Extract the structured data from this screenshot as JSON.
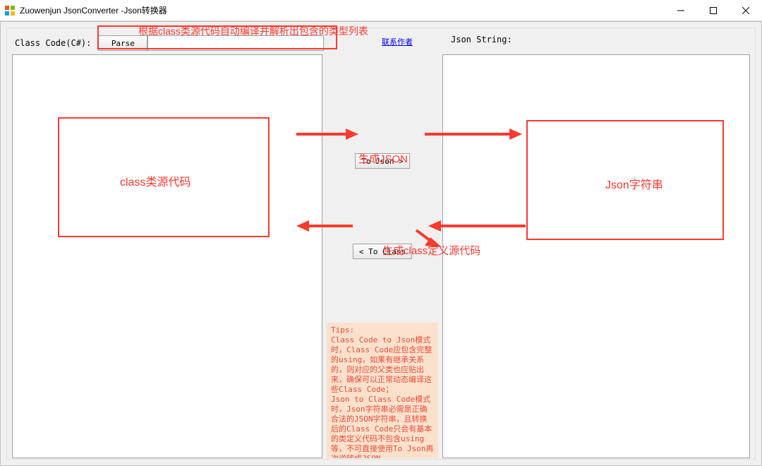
{
  "window": {
    "title": "Zuowenjun JsonConverter -Json转换器"
  },
  "toolbar": {
    "class_code_label": "Class Code(C#):",
    "parse_label": "Parse",
    "combo_value": "",
    "author_link": "联系作者",
    "json_string_label": "Json String:"
  },
  "buttons": {
    "to_json": "To Json >",
    "to_class": "< To Class"
  },
  "tips": {
    "heading": "Tips:",
    "body": "Class Code to Json模式时，Class Code应包含完整的using，如果有继承关系的，则对应的父类也应贴出来，确保可以正常动态编译这些Class Code；\nJson to Class Code模式时，Json字符串必需是正确合法的JSON字符串，且转换后的Class Code只会有基本的类定义代码不包含using等，不可直接使用To Json再次逆转成JSON。"
  },
  "annotations": {
    "top_note": "根据class类源代码自动编译并解析出包含的类型列表",
    "left_box": "class类源代码",
    "right_box": "Json字符串",
    "gen_json": "生成JSON",
    "gen_class": "生成class定义源代码"
  }
}
